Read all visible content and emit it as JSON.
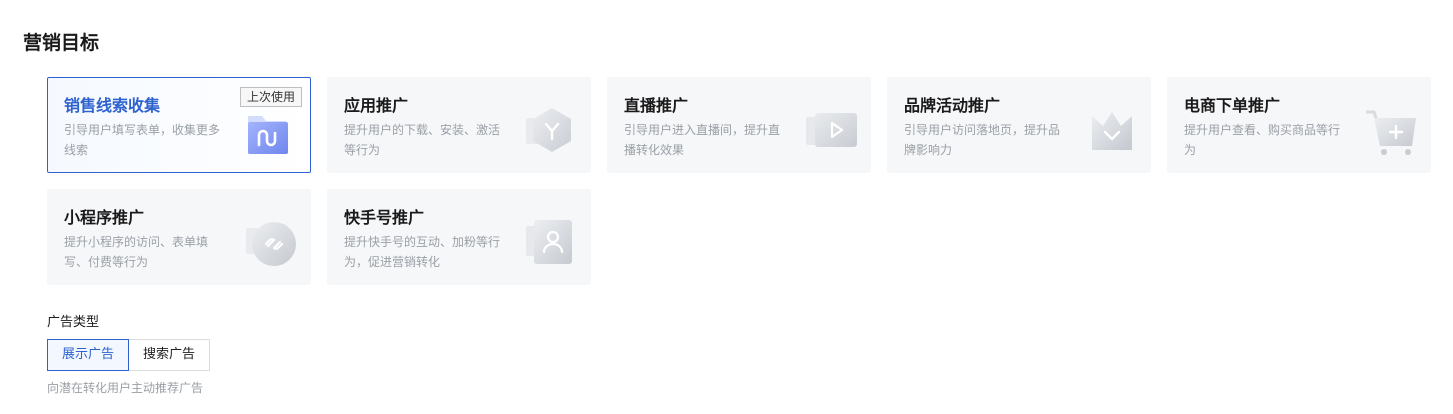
{
  "page": {
    "title": "营销目标"
  },
  "goals": [
    {
      "title": "销售线索收集",
      "desc": "引导用户填写表单，收集更多线索",
      "badge": "上次使用",
      "icon": "folder-form-icon"
    },
    {
      "title": "应用推广",
      "desc": "提升用户的下载、安装、激活等行为",
      "icon": "app-hexagon-icon"
    },
    {
      "title": "直播推广",
      "desc": "引导用户进入直播间，提升直播转化效果",
      "icon": "live-play-icon"
    },
    {
      "title": "品牌活动推广",
      "desc": "引导用户访问落地页，提升品牌影响力",
      "icon": "brand-crown-icon"
    },
    {
      "title": "电商下单推广",
      "desc": "提升用户查看、购买商品等行为",
      "icon": "shopping-cart-icon"
    },
    {
      "title": "小程序推广",
      "desc": "提升小程序的访问、表单填写、付费等行为",
      "icon": "mini-program-icon"
    },
    {
      "title": "快手号推广",
      "desc": "提升快手号的互动、加粉等行为，促进营销转化",
      "icon": "account-profile-icon"
    }
  ],
  "ad_type": {
    "label": "广告类型",
    "options": [
      "展示广告",
      "搜索广告"
    ],
    "selected": "展示广告",
    "hint": "向潜在转化用户主动推荐广告"
  },
  "colors": {
    "accent": "#2e62cf",
    "card_bg": "#f6f7f9",
    "muted_text": "#9aa0a6"
  }
}
